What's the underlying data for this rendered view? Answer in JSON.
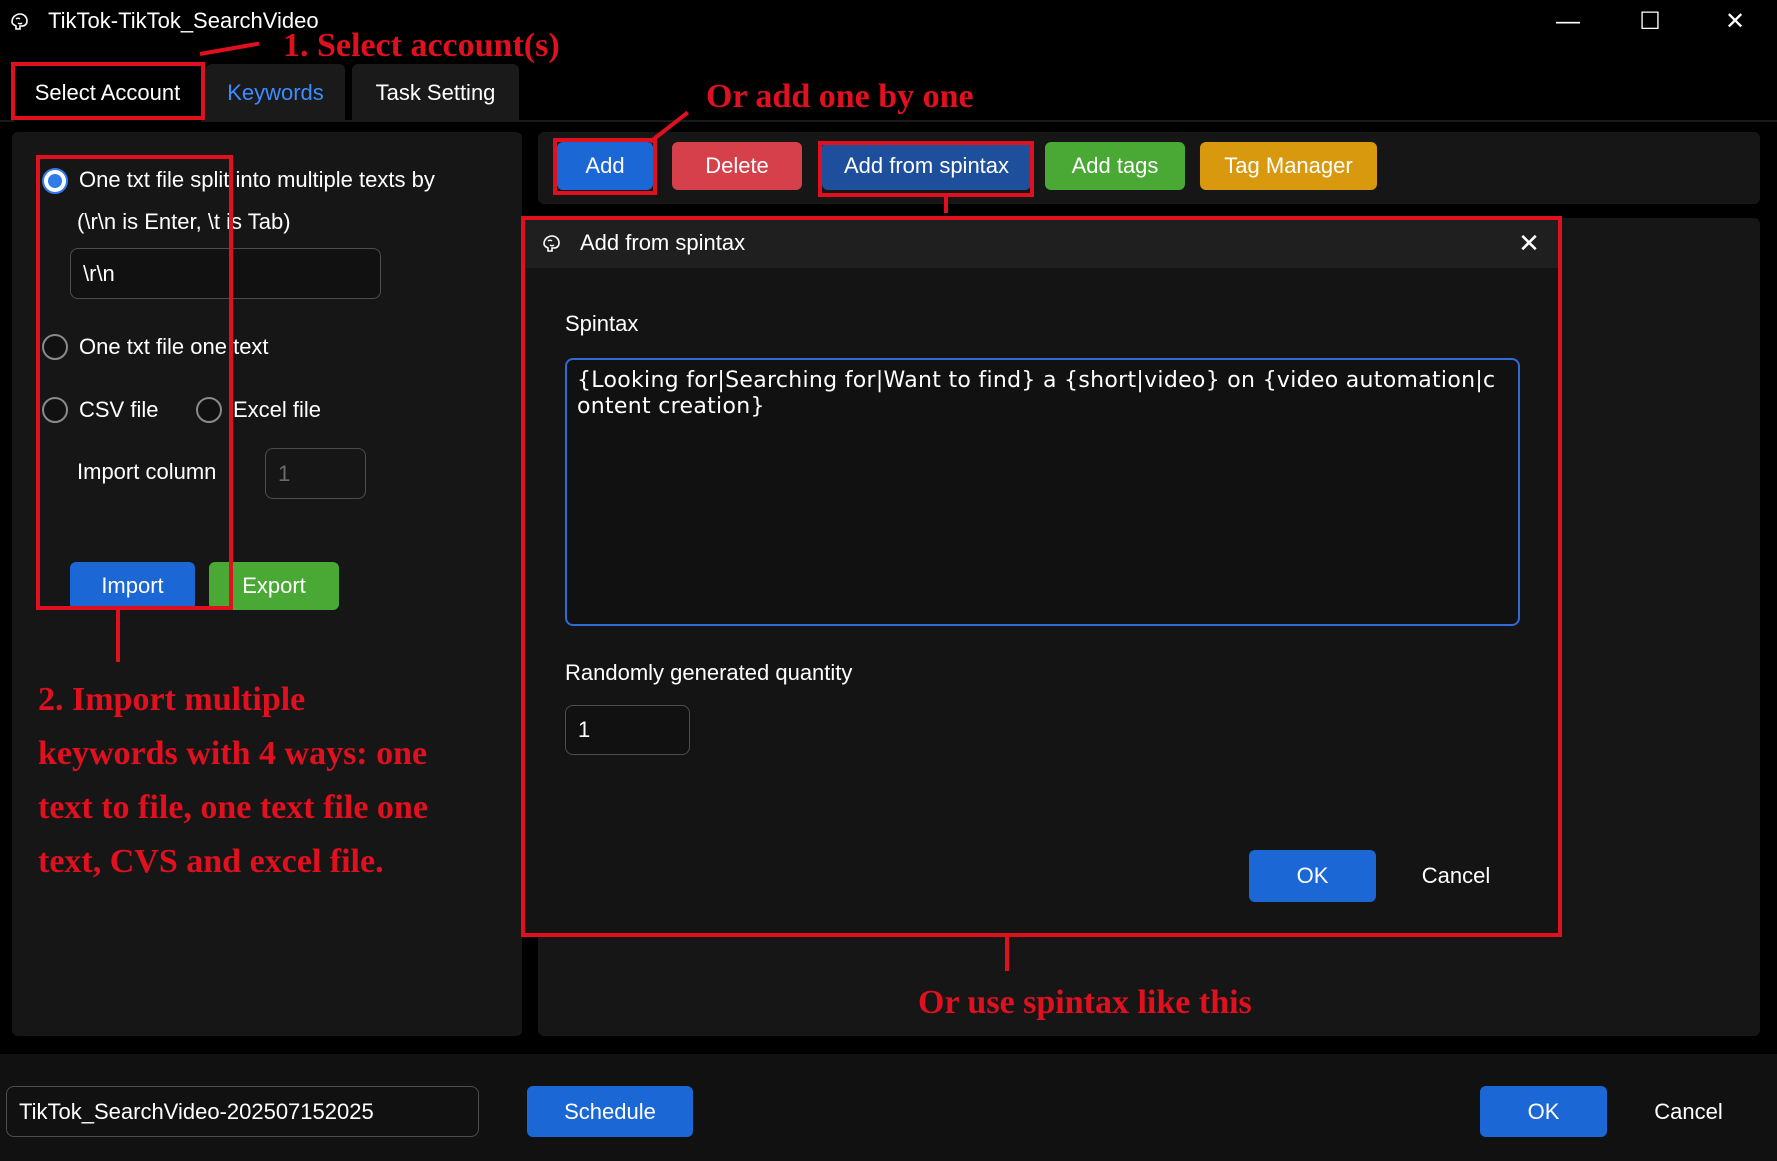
{
  "window": {
    "title": "TikTok-TikTok_SearchVideo",
    "minimize_glyph": "—",
    "maximize_glyph": "☐",
    "close_glyph": "✕"
  },
  "tabs": [
    {
      "label": "Select Account"
    },
    {
      "label": "Keywords",
      "active": true
    },
    {
      "label": "Task Setting"
    }
  ],
  "import": {
    "option_split_label": "One txt file split into multiple texts by",
    "option_split_hint": "(\\r\\n is Enter, \\t is Tab)",
    "delimiter_value": "\\r\\n",
    "option_one_text_label": "One txt file one text",
    "option_csv_label": "CSV file",
    "option_excel_label": "Excel file",
    "import_column_label": "Import column",
    "import_column_placeholder": "1",
    "import_button": "Import",
    "export_button": "Export"
  },
  "toolbar": {
    "add": "Add",
    "delete": "Delete",
    "add_from_spintax": "Add from spintax",
    "add_tags": "Add tags",
    "tag_manager": "Tag Manager"
  },
  "dialog": {
    "title": "Add from spintax",
    "close_glyph": "✕",
    "spintax_label": "Spintax",
    "spintax_value": "{Looking for|Searching for|Want to find} a {short|video} on {video automation|content creation}",
    "quantity_label": "Randomly generated quantity",
    "quantity_value": "1",
    "ok": "OK",
    "cancel": "Cancel"
  },
  "bottom": {
    "task_name": "TikTok_SearchVideo-202507152025",
    "schedule": "Schedule",
    "ok": "OK",
    "cancel": "Cancel"
  },
  "annotations": {
    "select_account": "1. Select account(s)",
    "add_one_by_one": "Or add one by one",
    "import_ways_lines": [
      "2. Import multiple",
      "keywords with 4 ways: one",
      "text to file, one text file one",
      "text, CVS and excel file."
    ],
    "use_spintax": "Or use spintax like this"
  },
  "colors": {
    "accent_blue": "#1b67d6",
    "delete_red": "#d6404a",
    "spintax_navy": "#1d4f9c",
    "tags_green": "#4aa834",
    "tag_manager_orange": "#d9990f",
    "annotation_red": "#e0101e",
    "active_tab_text": "#3d8cff"
  },
  "icons": {
    "app": "brain-icon",
    "dialog": "brain-icon"
  }
}
